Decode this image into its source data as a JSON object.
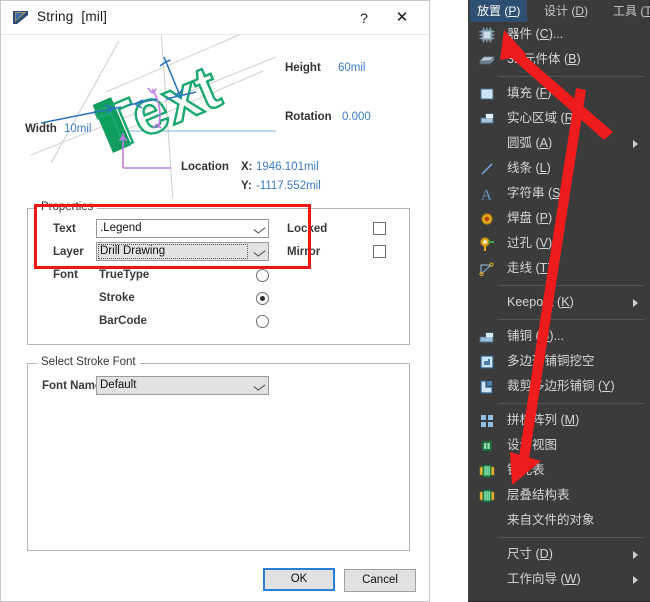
{
  "dialog": {
    "title": "String",
    "unit": "[mil]",
    "help_label": "?",
    "close_label": "✕",
    "icon": "altium-string-icon",
    "preview": {
      "sample_text": "Text",
      "width_label": "Width",
      "width_value": "10mil",
      "height_label": "Height",
      "height_value": "60mil",
      "rotation_label": "Rotation",
      "rotation_value": "0.000",
      "location_label": "Location",
      "location_x_label": "X:",
      "location_x_value": "1946.101mil",
      "location_y_label": "Y:",
      "location_y_value": "-1117.552mil"
    },
    "properties": {
      "group_title": "Properties",
      "text_label": "Text",
      "text_value": ".Legend",
      "layer_label": "Layer",
      "layer_value": "Drill Drawing",
      "font_label": "Font",
      "font_options": [
        "TrueType",
        "Stroke",
        "BarCode"
      ],
      "font_selected": "Stroke",
      "locked_label": "Locked",
      "locked_checked": false,
      "mirror_label": "Mirror",
      "mirror_checked": false
    },
    "stroke_font": {
      "group_title": "Select Stroke Font",
      "font_name_label": "Font Name",
      "font_name_value": "Default"
    },
    "buttons": {
      "ok": "OK",
      "cancel": "Cancel"
    }
  },
  "menu": {
    "menubar": [
      {
        "label": "放置",
        "accel": "P",
        "active": true
      },
      {
        "label": "设计",
        "accel": "D",
        "active": false
      },
      {
        "label": "工具",
        "accel": "T",
        "active": false
      }
    ],
    "items": [
      {
        "label": "器件",
        "accel": "C",
        "suffix": "...",
        "icon": "chip-icon",
        "submenu": false,
        "separator_after": false
      },
      {
        "label": "3D元件体",
        "accel": "B",
        "suffix": "",
        "icon": "3d-body-icon",
        "submenu": false,
        "separator_after": true
      },
      {
        "label": "填充",
        "accel": "F",
        "suffix": "",
        "icon": "fill-icon",
        "submenu": false,
        "separator_after": false
      },
      {
        "label": "实心区域",
        "accel": "R",
        "suffix": "",
        "icon": "solid-region-icon",
        "submenu": false,
        "separator_after": false
      },
      {
        "label": "圆弧",
        "accel": "A",
        "suffix": "",
        "icon": "none",
        "submenu": true,
        "separator_after": false
      },
      {
        "label": "线条",
        "accel": "L",
        "suffix": "",
        "icon": "line-icon",
        "submenu": false,
        "separator_after": false
      },
      {
        "label": "字符串",
        "accel": "S",
        "suffix": "",
        "icon": "text-string-icon",
        "submenu": false,
        "separator_after": false
      },
      {
        "label": "焊盘",
        "accel": "P",
        "suffix": "",
        "icon": "pad-icon",
        "submenu": false,
        "separator_after": false
      },
      {
        "label": "过孔",
        "accel": "V",
        "suffix": "",
        "icon": "via-icon",
        "submenu": false,
        "separator_after": false
      },
      {
        "label": "走线",
        "accel": "T",
        "suffix": "",
        "icon": "track-icon",
        "submenu": false,
        "separator_after": true
      },
      {
        "label": "Keepout",
        "accel": "K",
        "suffix": "",
        "icon": "none",
        "submenu": true,
        "separator_after": true
      },
      {
        "label": "铺铜",
        "accel": "G",
        "suffix": "...",
        "icon": "polygon-pour-icon",
        "submenu": false,
        "separator_after": false
      },
      {
        "label": "多边形铺铜挖空",
        "accel": "",
        "suffix": "",
        "icon": "polygon-cutout-icon",
        "submenu": false,
        "separator_after": false
      },
      {
        "label": "裁剪多边形铺铜",
        "accel": "Y",
        "suffix": "",
        "icon": "polygon-slice-icon",
        "submenu": false,
        "separator_after": true
      },
      {
        "label": "拼板阵列",
        "accel": "M",
        "suffix": "",
        "icon": "panel-array-icon",
        "submenu": false,
        "separator_after": false
      },
      {
        "label": "设计视图",
        "accel": "",
        "suffix": "",
        "icon": "design-view-icon",
        "submenu": false,
        "separator_after": false
      },
      {
        "label": "钻孔表",
        "accel": "",
        "suffix": "",
        "icon": "drill-table-icon",
        "submenu": false,
        "separator_after": false
      },
      {
        "label": "层叠结构表",
        "accel": "",
        "suffix": "",
        "icon": "layerstack-table-icon",
        "submenu": false,
        "separator_after": false
      },
      {
        "label": "来自文件的对象",
        "accel": "",
        "suffix": "",
        "icon": "none",
        "submenu": false,
        "separator_after": true
      },
      {
        "label": "尺寸",
        "accel": "D",
        "suffix": "",
        "icon": "none",
        "submenu": true,
        "separator_after": false
      },
      {
        "label": "工作向导",
        "accel": "W",
        "suffix": "",
        "icon": "none",
        "submenu": true,
        "separator_after": false
      }
    ]
  },
  "annotations": {
    "arrow_color": "#ee1c1c",
    "highlight_box_color": "#f01515",
    "arrow_count": 2
  },
  "colors": {
    "accent_blue": "#3b7cc4",
    "menu_bg": "#3b3b3b",
    "menu_active": "#2d4f72",
    "text_green": "#13a060"
  }
}
